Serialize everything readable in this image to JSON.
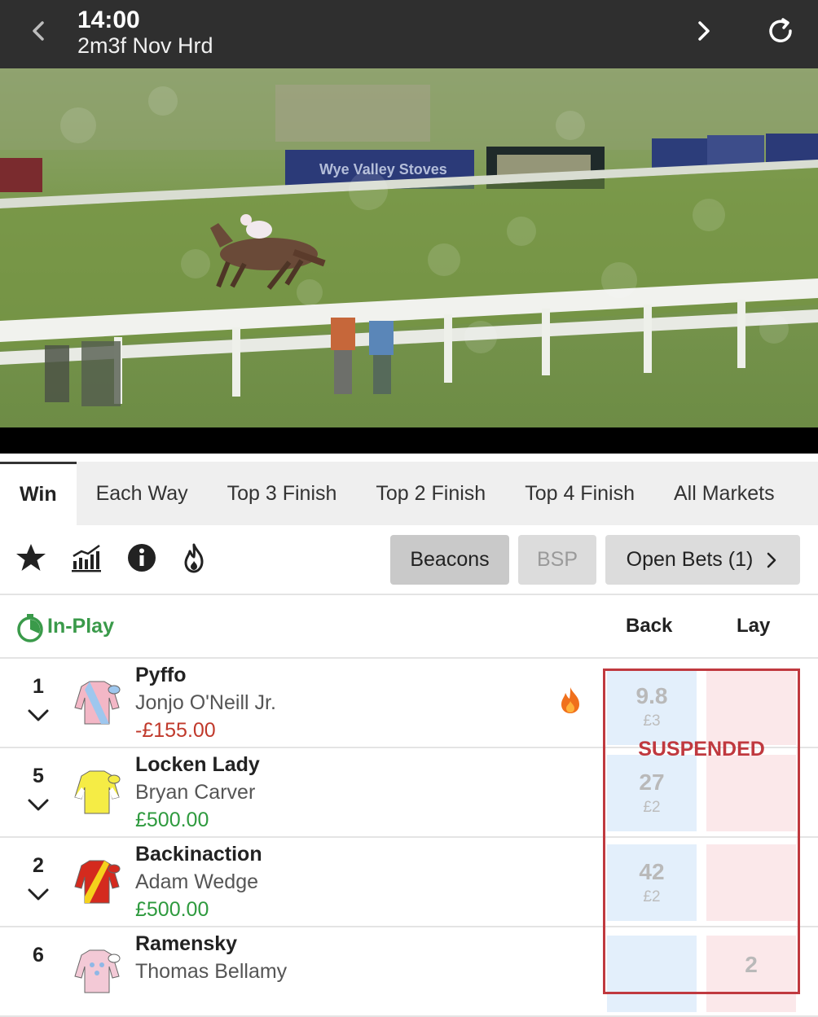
{
  "header": {
    "time": "14:00",
    "race": "2m3f Nov Hrd"
  },
  "video": {
    "ad_text": "Wye Valley Stoves"
  },
  "tabs": [
    {
      "label": "Win",
      "active": true
    },
    {
      "label": "Each Way",
      "active": false
    },
    {
      "label": "Top 3 Finish",
      "active": false
    },
    {
      "label": "Top 2 Finish",
      "active": false
    },
    {
      "label": "Top 4 Finish",
      "active": false
    },
    {
      "label": "All Markets",
      "active": false
    }
  ],
  "toolbar": {
    "icons": [
      "star-icon",
      "chart-icon",
      "info-icon",
      "fire-icon"
    ],
    "beacons_label": "Beacons",
    "bsp_label": "BSP",
    "open_bets_label": "Open Bets (1)"
  },
  "market": {
    "status_label": "In-Play",
    "back_label": "Back",
    "lay_label": "Lay",
    "suspended_label": "SUSPENDED",
    "colors": {
      "back": "#e3effb",
      "lay": "#fbe8ea",
      "suspended": "#c0393f",
      "in_play": "#3a9a4a"
    }
  },
  "runners": [
    {
      "number": "1",
      "name": "Pyffo",
      "jockey": "Jonjo O'Neill Jr.",
      "pl": "-£155.00",
      "pl_type": "neg",
      "hot": true,
      "back_odds": "9.8",
      "back_stake": "£3",
      "lay_odds": "",
      "lay_stake": ""
    },
    {
      "number": "5",
      "name": "Locken Lady",
      "jockey": "Bryan Carver",
      "pl": "£500.00",
      "pl_type": "pos",
      "hot": false,
      "back_odds": "27",
      "back_stake": "£2",
      "lay_odds": "",
      "lay_stake": ""
    },
    {
      "number": "2",
      "name": "Backinaction",
      "jockey": "Adam Wedge",
      "pl": "£500.00",
      "pl_type": "pos",
      "hot": false,
      "back_odds": "42",
      "back_stake": "£2",
      "lay_odds": "",
      "lay_stake": ""
    },
    {
      "number": "6",
      "name": "Ramensky",
      "jockey": "Thomas Bellamy",
      "pl": "",
      "pl_type": "pos",
      "hot": false,
      "back_odds": "",
      "back_stake": "",
      "lay_odds": "2",
      "lay_stake": ""
    }
  ]
}
